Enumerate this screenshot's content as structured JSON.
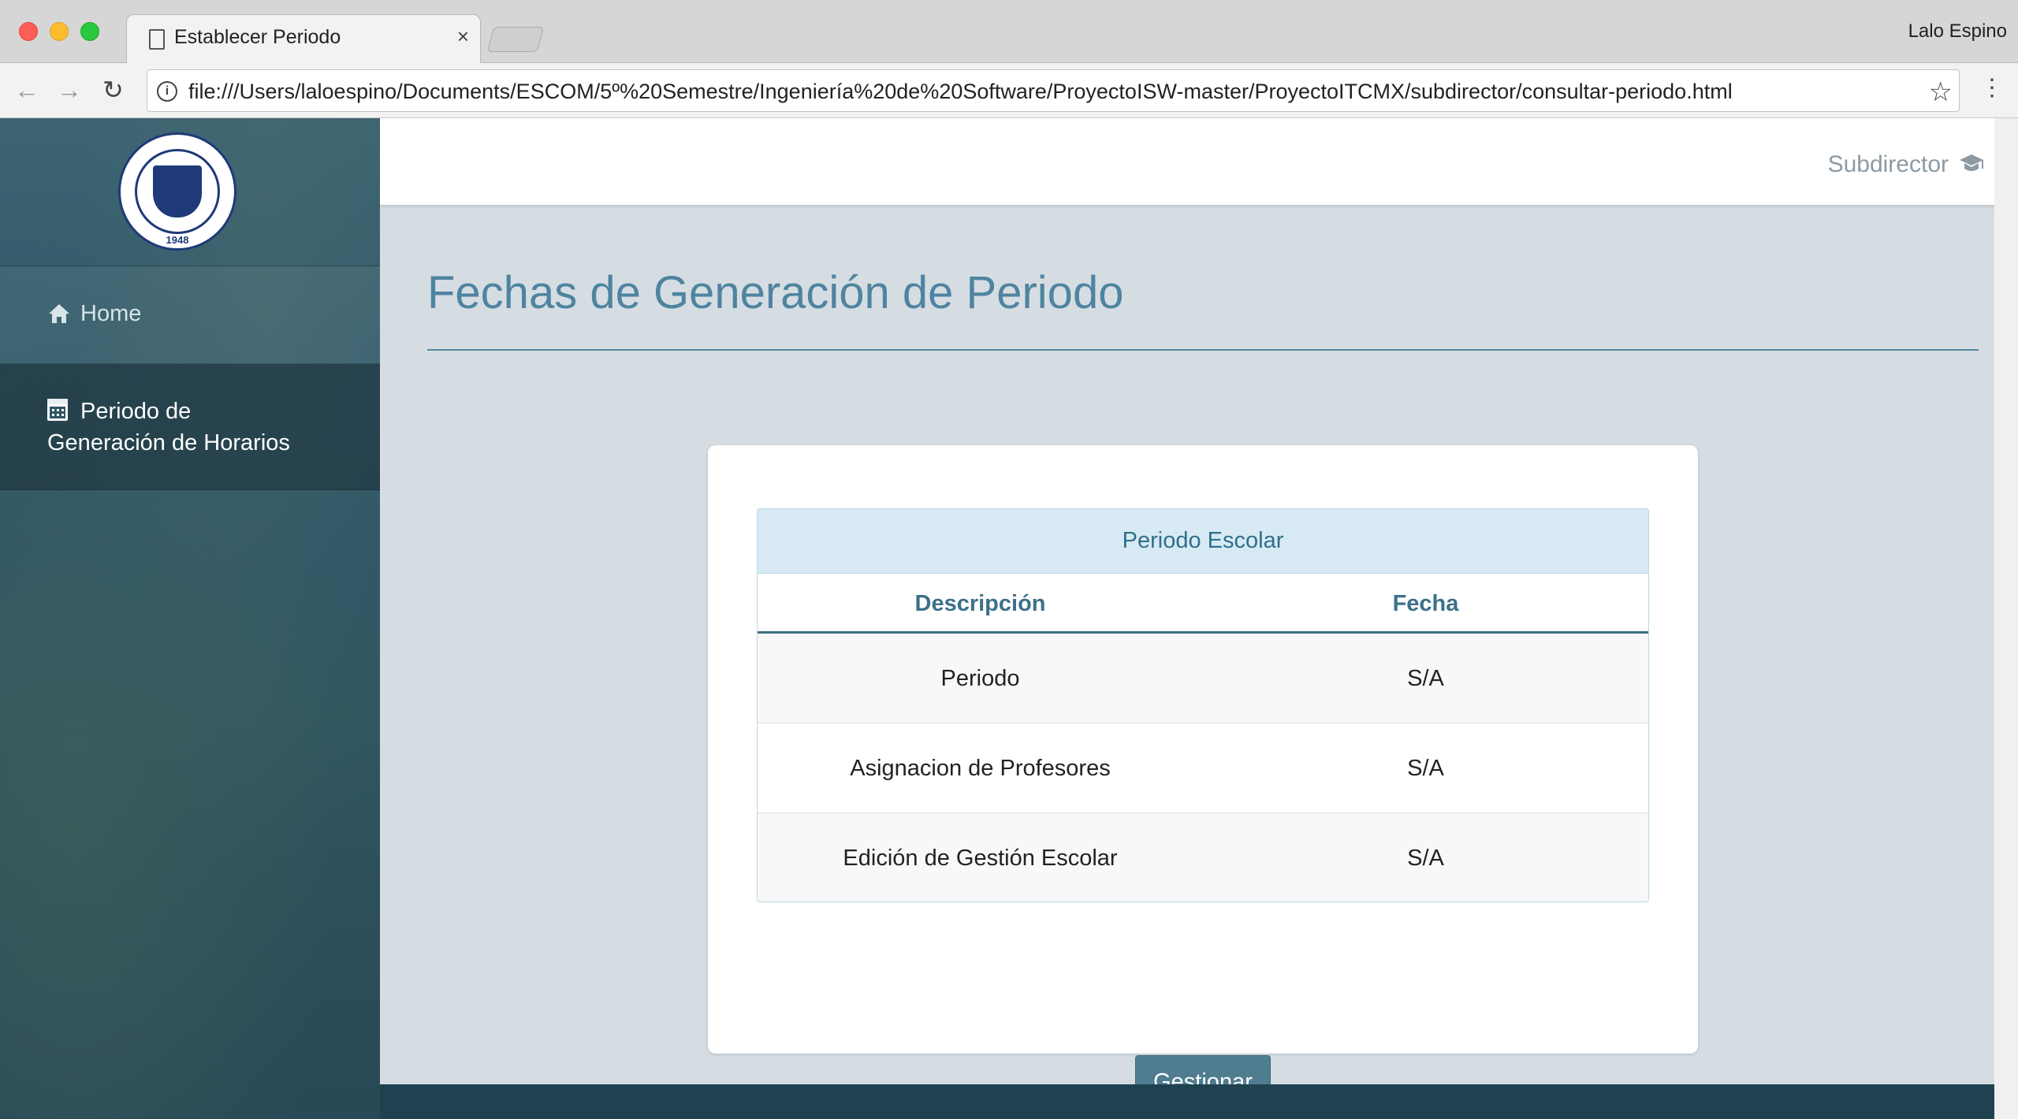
{
  "browser": {
    "tab_title": "Establecer Periodo",
    "tab_close": "×",
    "user_name": "Lalo Espino",
    "url": "file:///Users/laloespino/Documents/ESCOM/5º%20Semestre/Ingeniería%20de%20Software/ProyectoISW-master/ProyectoITCMX/subdirector/consultar-periodo.html"
  },
  "sidebar": {
    "logo_year": "1948",
    "items": [
      {
        "label": "Home",
        "icon": "home-icon"
      },
      {
        "label_line1": "Periodo de",
        "label_line2": "Generación de Horarios",
        "icon": "calendar-icon"
      }
    ]
  },
  "header": {
    "role": "Subdirector",
    "role_icon": "graduation-cap-icon"
  },
  "main": {
    "title": "Fechas de Generación de Periodo",
    "table": {
      "caption": "Periodo Escolar",
      "columns": [
        "Descripción",
        "Fecha"
      ],
      "rows": [
        [
          "Periodo",
          "S/A"
        ],
        [
          "Asignacion de Profesores",
          "S/A"
        ],
        [
          "Edición de Gestión Escolar",
          "S/A"
        ]
      ]
    },
    "button_label": "Gestionar"
  },
  "colors": {
    "accent": "#4f84a0",
    "sidebar": "#2f5666",
    "button": "#4f7d8f",
    "table_caption_bg": "#d7eaf3"
  }
}
